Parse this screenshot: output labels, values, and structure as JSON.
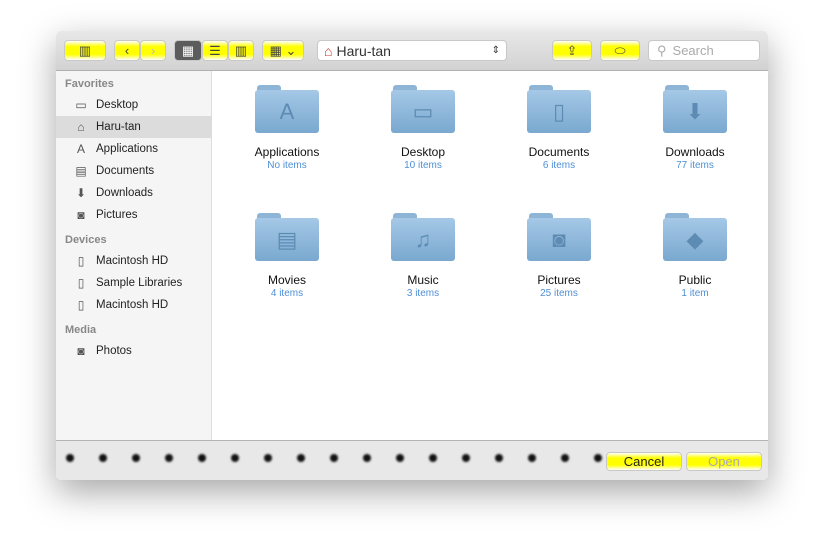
{
  "toolbar": {
    "path": "Haru-tan",
    "search_placeholder": "Search"
  },
  "sidebar": {
    "sections": [
      {
        "title": "Favorites",
        "items": [
          {
            "label": "Desktop",
            "icon": "desktop-icon"
          },
          {
            "label": "Haru-tan",
            "icon": "home-icon",
            "active": true
          },
          {
            "label": "Applications",
            "icon": "applications-icon"
          },
          {
            "label": "Documents",
            "icon": "document-icon"
          },
          {
            "label": "Downloads",
            "icon": "download-icon"
          },
          {
            "label": "Pictures",
            "icon": "camera-icon"
          }
        ]
      },
      {
        "title": "Devices",
        "items": [
          {
            "label": "Macintosh HD",
            "icon": "disk-icon"
          },
          {
            "label": "Sample Libraries",
            "icon": "disk-icon"
          },
          {
            "label": "Macintosh HD",
            "icon": "disk-icon"
          }
        ]
      },
      {
        "title": "Media",
        "items": [
          {
            "label": "Photos",
            "icon": "camera-icon"
          }
        ]
      }
    ]
  },
  "folders": [
    {
      "name": "Applications",
      "count": "No items",
      "glyph": "A"
    },
    {
      "name": "Desktop",
      "count": "10 items",
      "glyph": "▭"
    },
    {
      "name": "Documents",
      "count": "6 items",
      "glyph": "▯"
    },
    {
      "name": "Downloads",
      "count": "77 items",
      "glyph": "⬇"
    },
    {
      "name": "Movies",
      "count": "4 items",
      "glyph": "▤"
    },
    {
      "name": "Music",
      "count": "3 items",
      "glyph": "♫"
    },
    {
      "name": "Pictures",
      "count": "25 items",
      "glyph": "◙"
    },
    {
      "name": "Public",
      "count": "1 item",
      "glyph": "◆"
    }
  ],
  "buttons": {
    "cancel": "Cancel",
    "open": "Open"
  }
}
